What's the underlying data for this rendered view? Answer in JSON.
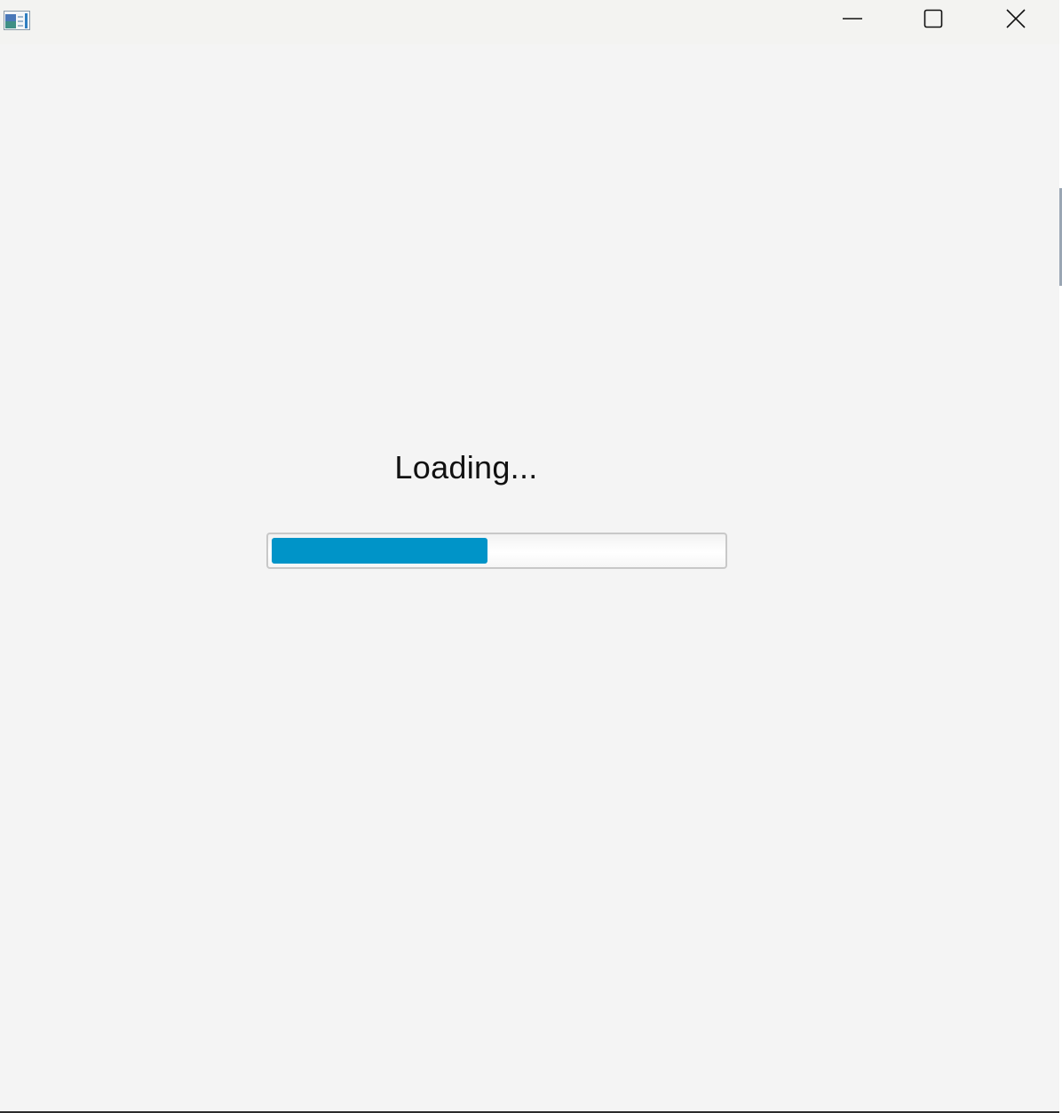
{
  "window": {
    "app_icon": "app-window-icon",
    "controls": {
      "minimize_icon": "minimize-icon",
      "maximize_icon": "maximize-icon",
      "close_icon": "close-icon"
    }
  },
  "main": {
    "status_text": "Loading...",
    "progress": {
      "fraction": 0.48,
      "fill_color": "#0094c8"
    }
  }
}
